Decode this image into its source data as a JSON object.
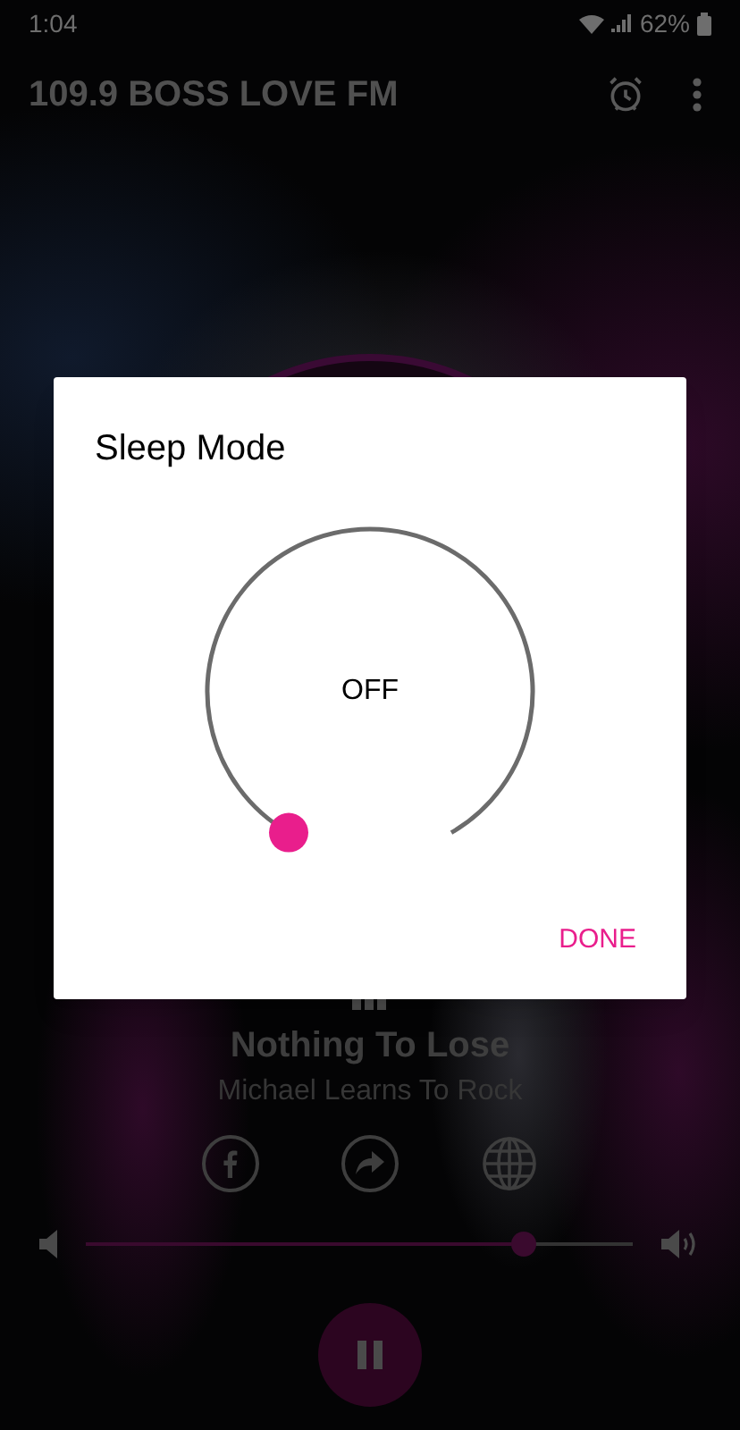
{
  "status_bar": {
    "time": "1:04",
    "battery": "62%"
  },
  "toolbar": {
    "title": "109.9 BOSS LOVE FM"
  },
  "dialog": {
    "title": "Sleep Mode",
    "dial": {
      "reading": "OFF"
    },
    "button": "DONE"
  },
  "now_playing": {
    "title": "Nothing To Lose",
    "artist": "Michael Learns To Rock"
  },
  "volume": {
    "level": 0.8
  },
  "player": {
    "playing": true
  }
}
